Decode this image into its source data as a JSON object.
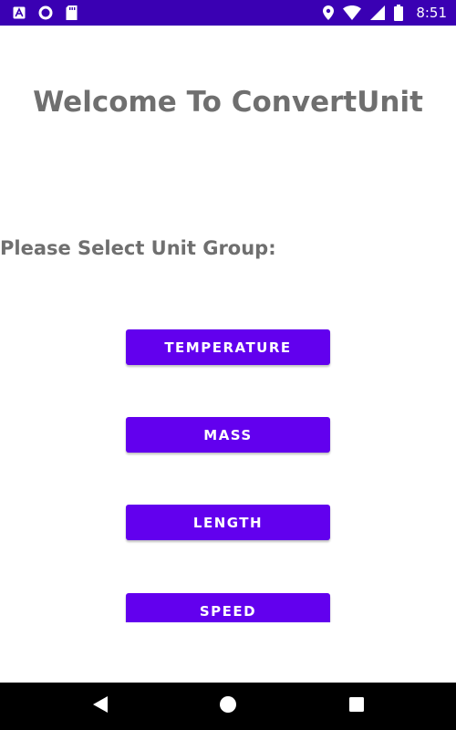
{
  "status_bar": {
    "time": "8:51",
    "background": "#3a00b3",
    "left_icons": [
      "a-icon",
      "circle-icon",
      "sd-card-icon"
    ],
    "right_icons": [
      "location-icon",
      "wifi-icon",
      "signal-icon",
      "battery-icon"
    ]
  },
  "main": {
    "title": "Welcome To ConvertUnit",
    "subtitle": "Please Select Unit Group:",
    "buttons": [
      {
        "label": "TEMPERATURE"
      },
      {
        "label": "MASS"
      },
      {
        "label": "LENGTH"
      },
      {
        "label": "SPEED"
      }
    ],
    "button_color": "#6200ee",
    "text_color": "#6f6f6f"
  },
  "nav_bar": {
    "icons": [
      "back-icon",
      "home-icon",
      "recent-apps-icon"
    ]
  }
}
